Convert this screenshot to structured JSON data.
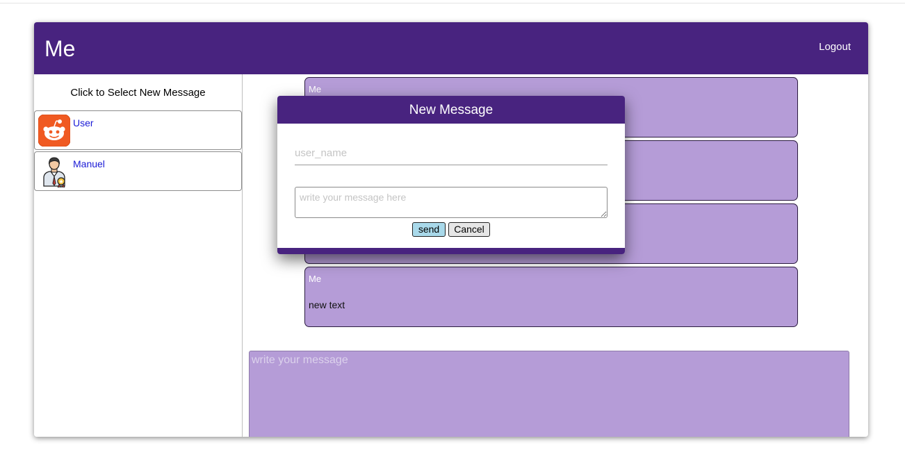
{
  "header": {
    "title": "Me",
    "logout_label": "Logout"
  },
  "sidebar": {
    "hint": "Click to Select New Message",
    "contacts": [
      {
        "name": "User",
        "icon": "reddit-alien-icon"
      },
      {
        "name": "Manuel",
        "icon": "businessman-award-icon"
      }
    ]
  },
  "messages": [
    {
      "sender": "Me",
      "text": ""
    },
    {
      "sender": "",
      "text": ""
    },
    {
      "sender": "",
      "text": ""
    },
    {
      "sender": "Me",
      "text": "new text"
    }
  ],
  "compose": {
    "placeholder": "write your message"
  },
  "modal": {
    "title": "New Message",
    "username_placeholder": "user_name",
    "message_placeholder": "write your message here",
    "send_label": "send",
    "cancel_label": "Cancel"
  },
  "colors": {
    "header": "#48237f",
    "bubble": "#b59cd7",
    "contact_name": "#1a1ad6",
    "send_button": "#a9d9ea"
  }
}
